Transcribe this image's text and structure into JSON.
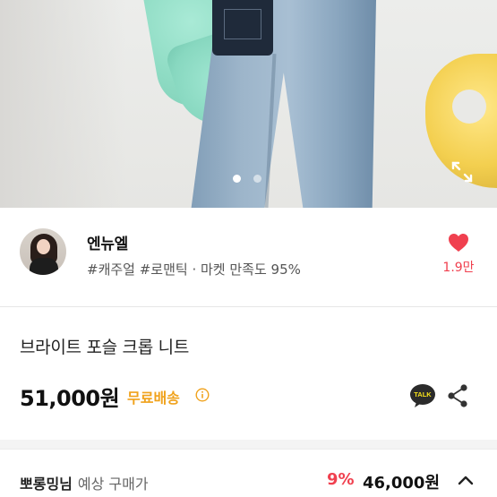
{
  "hero": {
    "image_alt": "product photo",
    "dots": [
      {
        "active": true
      },
      {
        "active": false
      }
    ],
    "expand_icon": "expand-icon"
  },
  "seller": {
    "name": "엔뉴엘",
    "tags": "#캐주얼 #로맨틱 · 마켓 만족도 95%",
    "likes": "1.9만",
    "like_icon": "heart-icon"
  },
  "product": {
    "title": "브라이트 포슬 크롭 니트",
    "price": "51,000원",
    "shipping": "무료배송",
    "talk_label": "TALK"
  },
  "expected": {
    "buyer": "뽀롱밍님",
    "label": "예상 구매가",
    "discount": "9%",
    "price": "46,000원"
  },
  "colors": {
    "accent_red": "#f0404f",
    "shipping_orange": "#f0a21c",
    "kakao_yellow": "#f7e21b"
  }
}
